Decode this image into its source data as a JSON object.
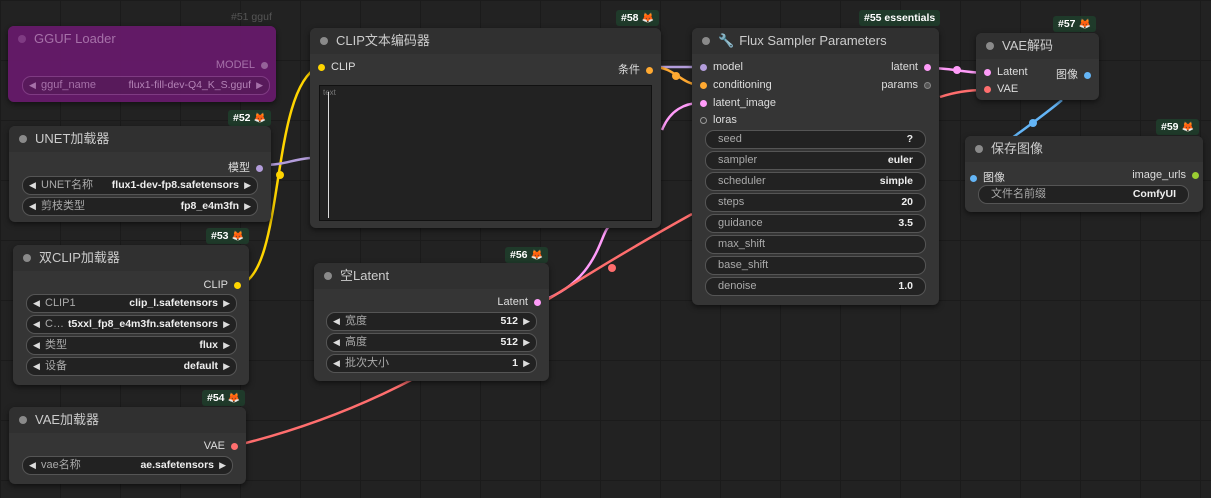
{
  "nodes": {
    "gguf": {
      "title": "GGUF Loader",
      "badge": "#51 gguf",
      "output": "MODEL",
      "widget_label": "gguf_name",
      "widget_value": "flux1-fill-dev-Q4_K_S.gguf"
    },
    "unet": {
      "title": "UNET加载器",
      "badge": "#52",
      "output": "模型",
      "w1_label": "UNET名称",
      "w1_value": "flux1-dev-fp8.safetensors",
      "w2_label": "剪枝类型",
      "w2_value": "fp8_e4m3fn"
    },
    "dualclip": {
      "title": "双CLIP加载器",
      "badge": "#53",
      "output": "CLIP",
      "w1_label": "CLIP1",
      "w1_value": "clip_l.safetensors",
      "w2_label": "C…",
      "w2_value": "t5xxl_fp8_e4m3fn.safetensors",
      "w3_label": "类型",
      "w3_value": "flux",
      "w4_label": "设备",
      "w4_value": "default"
    },
    "vaeloader": {
      "title": "VAE加载器",
      "badge": "#54",
      "output": "VAE",
      "w1_label": "vae名称",
      "w1_value": "ae.safetensors"
    },
    "clipenc": {
      "title": "CLIP文本编码器",
      "badge": "#58",
      "input": "CLIP",
      "output": "条件",
      "placeholder": "text"
    },
    "latent": {
      "title": "空Latent",
      "badge": "#56",
      "output": "Latent",
      "w1_label": "宽度",
      "w1_value": "512",
      "w2_label": "高度",
      "w2_value": "512",
      "w3_label": "批次大小",
      "w3_value": "1"
    },
    "sampler": {
      "title": "Flux Sampler Parameters",
      "badge": "#55 essentials",
      "inputs": [
        "model",
        "conditioning",
        "latent_image",
        "loras"
      ],
      "outputs": [
        "latent",
        "params"
      ],
      "widgets": [
        {
          "label": "seed",
          "value": "?"
        },
        {
          "label": "sampler",
          "value": "euler"
        },
        {
          "label": "scheduler",
          "value": "simple"
        },
        {
          "label": "steps",
          "value": "20"
        },
        {
          "label": "guidance",
          "value": "3.5"
        },
        {
          "label": "max_shift",
          "value": ""
        },
        {
          "label": "base_shift",
          "value": ""
        },
        {
          "label": "denoise",
          "value": "1.0"
        }
      ]
    },
    "vaedecode": {
      "title": "VAE解码",
      "badge": "#57",
      "in1": "Latent",
      "in2": "VAE",
      "output": "图像"
    },
    "save": {
      "title": "保存图像",
      "badge": "#59",
      "input": "图像",
      "output": "image_urls",
      "w1_label": "文件名前缀",
      "w1_value": "ComfyUI"
    }
  },
  "colors": {
    "model": "#b39ddb",
    "clip": "#ffd500",
    "cond": "#ffa931",
    "latent": "#ff9cf9",
    "vae": "#ff6e6e",
    "image": "#64b5f6",
    "string": "#9acd32"
  }
}
